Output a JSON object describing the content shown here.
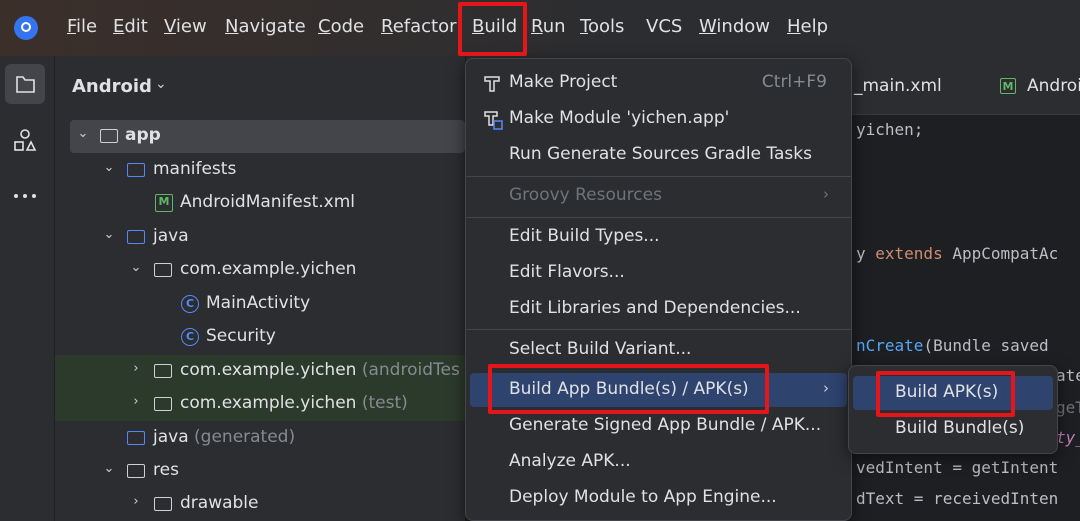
{
  "menubar": {
    "items": [
      {
        "label": "File"
      },
      {
        "label": "Edit"
      },
      {
        "label": "View"
      },
      {
        "label": "Navigate"
      },
      {
        "label": "Code"
      },
      {
        "label": "Refactor"
      },
      {
        "label": "Build"
      },
      {
        "label": "Run"
      },
      {
        "label": "Tools"
      },
      {
        "label": "VCS"
      },
      {
        "label": "Window"
      },
      {
        "label": "Help"
      }
    ]
  },
  "project_panel": {
    "title": "Android",
    "tree": [
      {
        "label": "app",
        "dim": ""
      },
      {
        "label": "manifests",
        "dim": ""
      },
      {
        "label": "AndroidManifest.xml",
        "dim": ""
      },
      {
        "label": "java",
        "dim": ""
      },
      {
        "label": "com.example.yichen",
        "dim": ""
      },
      {
        "label": "MainActivity",
        "dim": ""
      },
      {
        "label": "Security",
        "dim": ""
      },
      {
        "label": "com.example.yichen",
        "dim": "(androidTes"
      },
      {
        "label": "com.example.yichen",
        "dim": "(test)"
      },
      {
        "label": "java",
        "dim": "(generated)"
      },
      {
        "label": "res",
        "dim": ""
      },
      {
        "label": "drawable",
        "dim": ""
      }
    ]
  },
  "editor": {
    "tabs": [
      {
        "label": "_main.xml"
      },
      {
        "label": "Androi"
      }
    ],
    "code": {
      "l1": "yichen;",
      "l2_a": "y ",
      "l2_kw": "extends",
      "l2_b": " AppCompatAc",
      "l3_fn": "nCreate",
      "l3_b": "(Bundle saved",
      "l4": "ate",
      "l5": "geT",
      "l6": "ty_",
      "l7": "vedIntent = getIntent",
      "l8": "dText = receivedInten"
    }
  },
  "build_menu": {
    "items": [
      {
        "label": "Make Project",
        "shortcut": "Ctrl+F9"
      },
      {
        "label": "Make Module 'yichen.app'"
      },
      {
        "label": "Run Generate Sources Gradle Tasks"
      },
      {
        "label": "Groovy Resources"
      },
      {
        "label": "Edit Build Types..."
      },
      {
        "label": "Edit Flavors..."
      },
      {
        "label": "Edit Libraries and Dependencies..."
      },
      {
        "label": "Select Build Variant..."
      },
      {
        "label": "Build App Bundle(s) / APK(s)"
      },
      {
        "label": "Generate Signed App Bundle / APK..."
      },
      {
        "label": "Analyze APK..."
      },
      {
        "label": "Deploy Module to App Engine..."
      }
    ]
  },
  "build_submenu": {
    "items": [
      {
        "label": "Build APK(s)"
      },
      {
        "label": "Build Bundle(s)"
      }
    ]
  },
  "colors": {
    "accent": "#3574f0",
    "highlight": "#2e436e",
    "annotation": "#e4151b"
  }
}
